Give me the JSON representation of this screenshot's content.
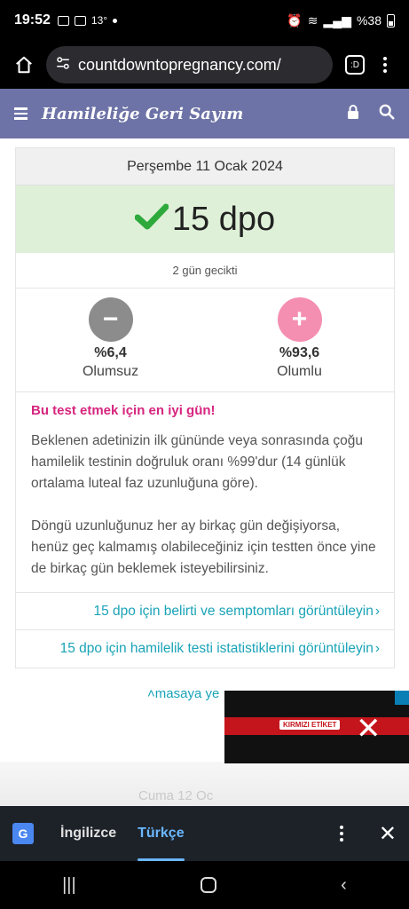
{
  "status": {
    "time": "19:52",
    "temp": "13°",
    "battery": "%38"
  },
  "browser": {
    "url": "countdowntopregnancy.com/",
    "tabs_label": ":D"
  },
  "header": {
    "title": "Hamileliğe Geri Sayım"
  },
  "card": {
    "date": "Perşembe 11 Ocak 2024",
    "dpo": "15 dpo",
    "late_status": "2 gün gecikti",
    "negative": {
      "percent": "%6,4",
      "label": "Olumsuz"
    },
    "positive": {
      "percent": "%93,6",
      "label": "Olumlu"
    },
    "info_title": "Bu test etmek için en iyi gün!",
    "paragraph1": "Beklenen adetinizin ilk gününde veya sonrasında çoğu hamilelik testinin doğruluk oranı %99'dur (14 günlük ortalama luteal faz uzunluğuna göre).",
    "paragraph2": "Döngü uzunluğunuz her ay birkaç gün değişiyorsa, henüz geç kalmamış olabileceğiniz için testten önce yine de birkaç gün beklemek isteyebilirsiniz.",
    "link1": "15 dpo için belirti ve semptomları görüntüleyin",
    "link2": "15 dpo için hamilelik testi istatistiklerini görüntüleyin"
  },
  "home_link": "masaya ye",
  "ad": {
    "brand": "KIRMIZI ETİKET"
  },
  "faded_text": "Cuma 12 Oc",
  "translate": {
    "lang_source": "İngilizce",
    "lang_target": "Türkçe"
  },
  "colors": {
    "header": "#6d73a6",
    "dpo_bg": "#dff0d8",
    "accent_pink": "#d6257e",
    "link": "#1aa3b7"
  }
}
